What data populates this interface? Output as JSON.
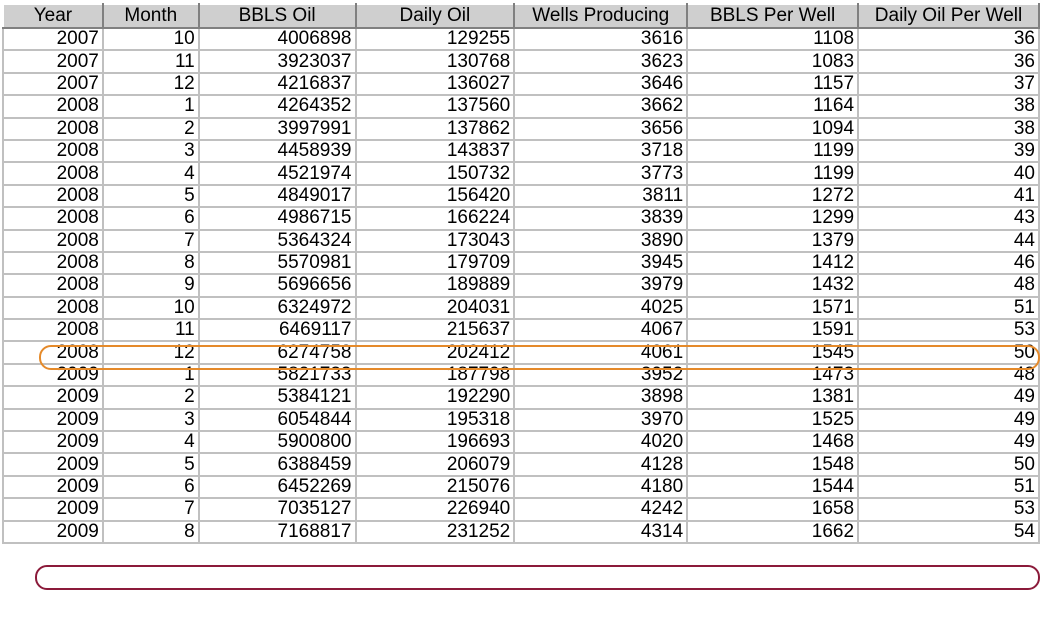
{
  "table": {
    "headers": [
      "Year",
      "Month",
      "BBLS Oil",
      "Daily Oil",
      "Wells Producing",
      "BBLS Per Well",
      "Daily Oil Per Well"
    ],
    "rows": [
      [
        "2007",
        "10",
        "4006898",
        "129255",
        "3616",
        "1108",
        "36"
      ],
      [
        "2007",
        "11",
        "3923037",
        "130768",
        "3623",
        "1083",
        "36"
      ],
      [
        "2007",
        "12",
        "4216837",
        "136027",
        "3646",
        "1157",
        "37"
      ],
      [
        "2008",
        "1",
        "4264352",
        "137560",
        "3662",
        "1164",
        "38"
      ],
      [
        "2008",
        "2",
        "3997991",
        "137862",
        "3656",
        "1094",
        "38"
      ],
      [
        "2008",
        "3",
        "4458939",
        "143837",
        "3718",
        "1199",
        "39"
      ],
      [
        "2008",
        "4",
        "4521974",
        "150732",
        "3773",
        "1199",
        "40"
      ],
      [
        "2008",
        "5",
        "4849017",
        "156420",
        "3811",
        "1272",
        "41"
      ],
      [
        "2008",
        "6",
        "4986715",
        "166224",
        "3839",
        "1299",
        "43"
      ],
      [
        "2008",
        "7",
        "5364324",
        "173043",
        "3890",
        "1379",
        "44"
      ],
      [
        "2008",
        "8",
        "5570981",
        "179709",
        "3945",
        "1412",
        "46"
      ],
      [
        "2008",
        "9",
        "5696656",
        "189889",
        "3979",
        "1432",
        "48"
      ],
      [
        "2008",
        "10",
        "6324972",
        "204031",
        "4025",
        "1571",
        "51"
      ],
      [
        "2008",
        "11",
        "6469117",
        "215637",
        "4067",
        "1591",
        "53"
      ],
      [
        "2008",
        "12",
        "6274758",
        "202412",
        "4061",
        "1545",
        "50"
      ],
      [
        "2009",
        "1",
        "5821733",
        "187798",
        "3952",
        "1473",
        "48"
      ],
      [
        "2009",
        "2",
        "5384121",
        "192290",
        "3898",
        "1381",
        "49"
      ],
      [
        "2009",
        "3",
        "6054844",
        "195318",
        "3970",
        "1525",
        "49"
      ],
      [
        "2009",
        "4",
        "5900800",
        "196693",
        "4020",
        "1468",
        "49"
      ],
      [
        "2009",
        "5",
        "6388459",
        "206079",
        "4128",
        "1548",
        "50"
      ],
      [
        "2009",
        "6",
        "6452269",
        "215076",
        "4180",
        "1544",
        "51"
      ],
      [
        "2009",
        "7",
        "7035127",
        "226940",
        "4242",
        "1658",
        "53"
      ],
      [
        "2009",
        "8",
        "7168817",
        "231252",
        "4314",
        "1662",
        "54"
      ]
    ]
  },
  "colors": {
    "highlight_orange": "#e58a2a",
    "highlight_maroon": "#8b1a3a",
    "header_background": "#cfcfcf",
    "grid_lines": "#c0c0c0"
  }
}
